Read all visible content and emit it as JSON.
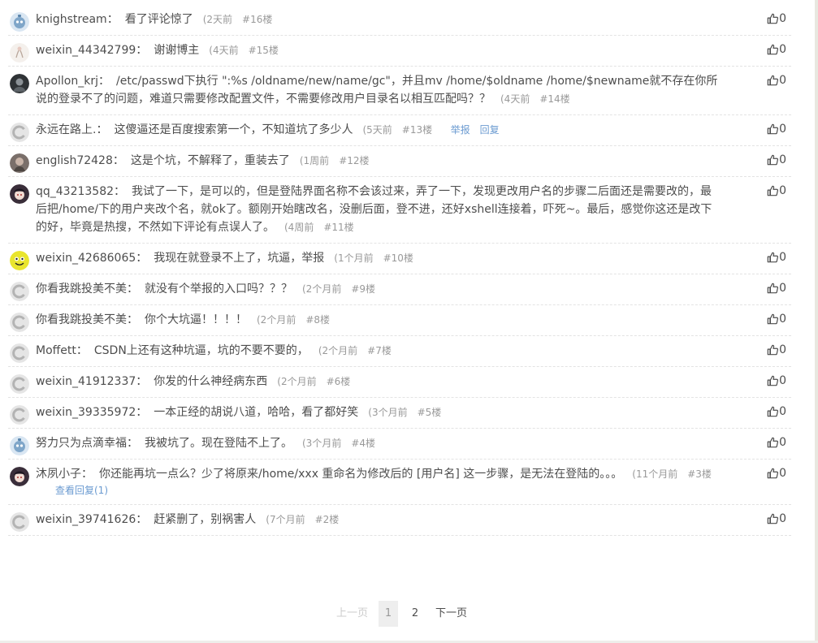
{
  "comments": [
    {
      "user": "knighstream",
      "text": "看了评论惊了",
      "time": "(2天前",
      "floor": "#16楼",
      "likes": "0",
      "avatar": "robot-avatar"
    },
    {
      "user": "weixin_44342799",
      "text": "谢谢博主",
      "time": "(4天前",
      "floor": "#15楼",
      "likes": "0",
      "avatar": "sketch-avatar"
    },
    {
      "user": "Apollon_krj",
      "text": "/etc/passwd下执行 \":%s /oldname/new/name/gc\"，并且mv /home/$oldname /home/$newname就不存在你所说的登录不了的问题，难道只需要修改配置文件，不需要修改用户目录名以相互匹配吗？？",
      "time": "(4天前",
      "floor": "#14楼",
      "likes": "0",
      "avatar": "dark-photo-avatar"
    },
    {
      "user": "永远在路上.",
      "text": "这傻逼还是百度搜索第一个，不知道坑了多少人",
      "time": "(5天前",
      "floor": "#13楼",
      "likes": "0",
      "avatar": "default-avatar",
      "report": "举报",
      "reply": "回复"
    },
    {
      "user": "english72428",
      "text": "这是个坑，不解释了，重装去了",
      "time": "(1周前",
      "floor": "#12楼",
      "likes": "0",
      "avatar": "photo-avatar"
    },
    {
      "user": "qq_43213582",
      "text": "我试了一下，是可以的，但是登陆界面名称不会该过来，弄了一下，发现更改用户名的步骤二后面还是需要改的，最后把/home/下的用户夹改个名，就ok了。额刚开始瞎改名，没删后面，登不进，还好xshell连接着，吓死~。最后，感觉你这还是改下的好，毕竟是热搜，不然如下评论有点误人了。",
      "time": "(4周前",
      "floor": "#11楼",
      "likes": "0",
      "avatar": "anime-avatar"
    },
    {
      "user": "weixin_42686065",
      "text": "我现在就登录不上了，坑逼，举报",
      "time": "(1个月前",
      "floor": "#10楼",
      "likes": "0",
      "avatar": "smiley-avatar"
    },
    {
      "user": "你看我跳投美不美",
      "text": "就没有个举报的入口吗？？？",
      "time": "(2个月前",
      "floor": "#9楼",
      "likes": "0",
      "avatar": "default-avatar"
    },
    {
      "user": "你看我跳投美不美",
      "text": "你个大坑逼！！！！",
      "time": "(2个月前",
      "floor": "#8楼",
      "likes": "0",
      "avatar": "default-avatar"
    },
    {
      "user": "Moffett",
      "text": "CSDN上还有这种坑逼，坑的不要不要的，",
      "time": "(2个月前",
      "floor": "#7楼",
      "likes": "0",
      "avatar": "default-avatar"
    },
    {
      "user": "weixin_41912337",
      "text": "你发的什么神经病东西",
      "time": "(2个月前",
      "floor": "#6楼",
      "likes": "0",
      "avatar": "default-avatar"
    },
    {
      "user": "weixin_39335972",
      "text": "一本正经的胡说八道，哈哈，看了都好笑",
      "time": "(3个月前",
      "floor": "#5楼",
      "likes": "0",
      "avatar": "default-avatar"
    },
    {
      "user": "努力只为点滴幸福",
      "text": "我被坑了。现在登陆不上了。",
      "time": "(3个月前",
      "floor": "#4楼",
      "likes": "0",
      "avatar": "robot-avatar"
    },
    {
      "user": "沐夙小子",
      "text": "你还能再坑一点么？少了将原来/home/xxx 重命名为修改后的 [用户名] 这一步骤，是无法在登陆的。。。",
      "time": "(11个月前",
      "floor": "#3楼",
      "likes": "0",
      "avatar": "anime-avatar",
      "view_reply": "查看回复(1)"
    },
    {
      "user": "weixin_39741626",
      "text": "赶紧删了，别祸害人",
      "time": "(7个月前",
      "floor": "#2楼",
      "likes": "0",
      "avatar": "default-avatar"
    }
  ],
  "pagination": {
    "prev": "上一页",
    "pages": [
      "1",
      "2"
    ],
    "current": "1",
    "next": "下一页"
  },
  "colors": {
    "text": "#4d4d4d",
    "meta": "#999999",
    "link": "#6b9bd1",
    "divider": "#e3e3e3"
  }
}
